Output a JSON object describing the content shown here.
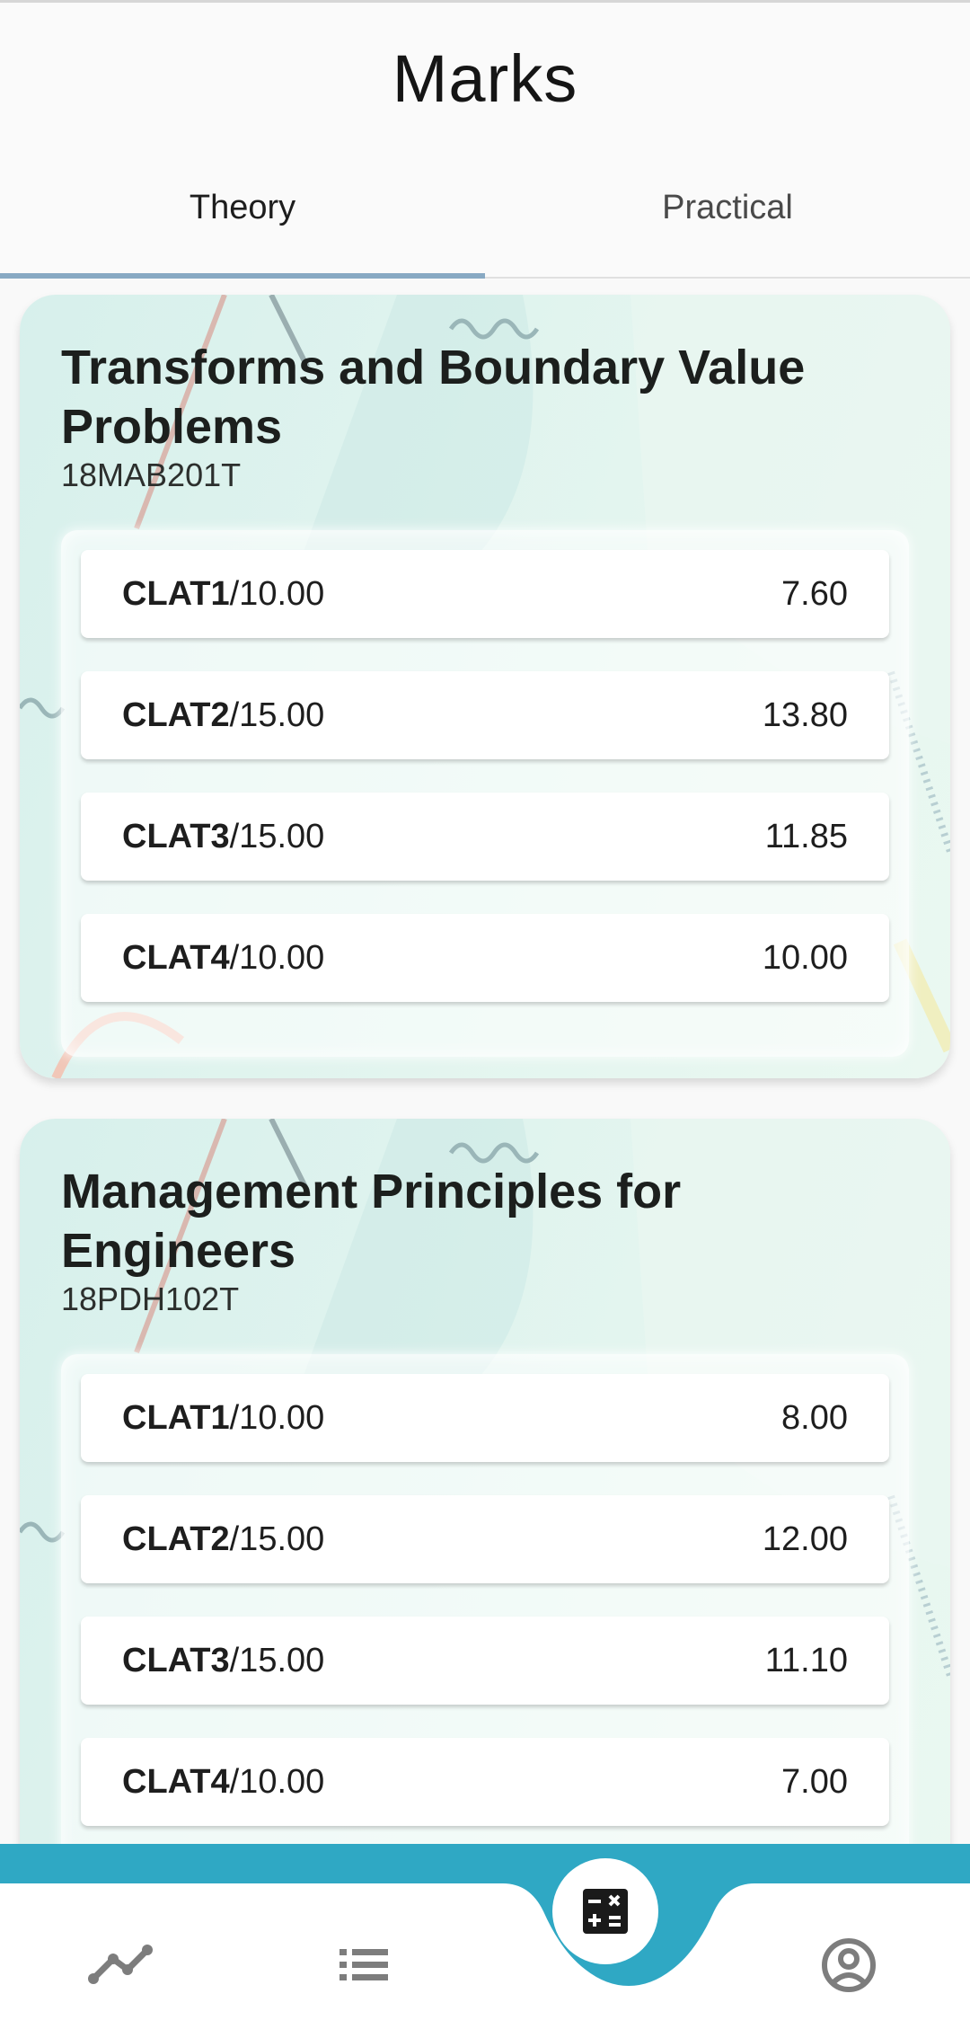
{
  "page_title": "Marks",
  "tabs": [
    {
      "label": "Theory",
      "active": true
    },
    {
      "label": "Practical",
      "active": false
    }
  ],
  "courses": [
    {
      "title": "Transforms and Boundary Value Problems",
      "code": "18MAB201T",
      "marks": [
        {
          "name": "CLAT1",
          "max": "/10.00",
          "value": "7.60"
        },
        {
          "name": "CLAT2",
          "max": "/15.00",
          "value": "13.80"
        },
        {
          "name": "CLAT3",
          "max": "/15.00",
          "value": "11.85"
        },
        {
          "name": "CLAT4",
          "max": "/10.00",
          "value": "10.00"
        }
      ]
    },
    {
      "title": "Management Principles for Engineers",
      "code": "18PDH102T",
      "marks": [
        {
          "name": "CLAT1",
          "max": "/10.00",
          "value": "8.00"
        },
        {
          "name": "CLAT2",
          "max": "/15.00",
          "value": "12.00"
        },
        {
          "name": "CLAT3",
          "max": "/15.00",
          "value": "11.10"
        },
        {
          "name": "CLAT4",
          "max": "/10.00",
          "value": "7.00"
        }
      ]
    }
  ],
  "bottom_nav": [
    {
      "icon": "trend-line-icon",
      "active": false
    },
    {
      "icon": "list-icon",
      "active": false
    },
    {
      "icon": "calculator-icon",
      "active": true
    },
    {
      "icon": "profile-icon",
      "active": false
    }
  ],
  "colors": {
    "accent": "#2fa8c4",
    "tab_indicator": "#88a9c3",
    "card_bg": "#e3f5ef"
  }
}
